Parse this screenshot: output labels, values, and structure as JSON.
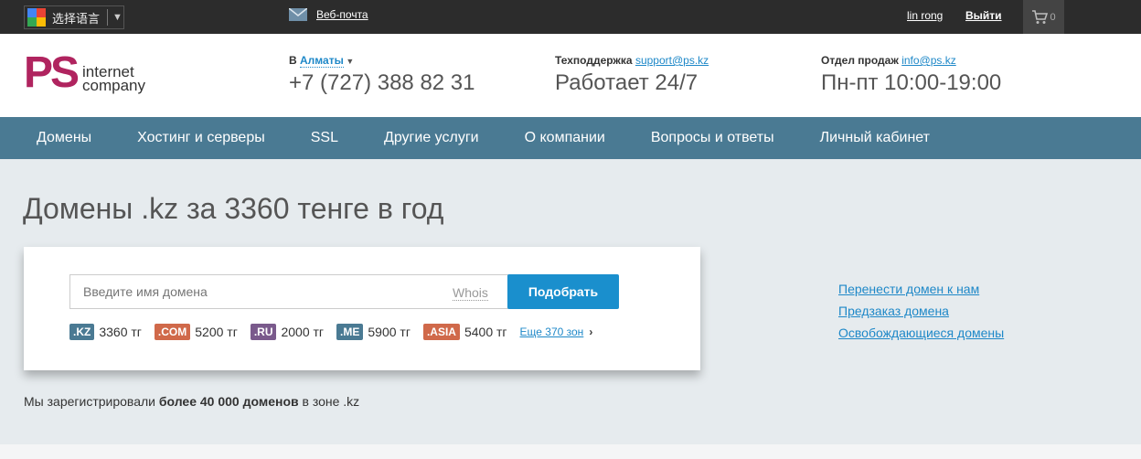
{
  "topbar": {
    "lang_label": "选择语言",
    "lang_arrow": "▼",
    "webmail": "Веб-почта",
    "user": "lin rong",
    "logout": "Выйти",
    "cart_count": "0"
  },
  "header": {
    "logo_ps": "PS",
    "logo_line1": "internet",
    "logo_line2": "company",
    "city_prefix": "В",
    "city": "Алматы",
    "phone": "+7 (727) 388 82 31",
    "support_label": "Техподдержка",
    "support_email": "support@ps.kz",
    "support_hours": "Работает 24/7",
    "sales_label": "Отдел продаж",
    "sales_email": "info@ps.kz",
    "sales_hours": "Пн-пт 10:00-19:00"
  },
  "nav": [
    {
      "label": "Домены"
    },
    {
      "label": "Хостинг и серверы"
    },
    {
      "label": "SSL"
    },
    {
      "label": "Другие услуги"
    },
    {
      "label": "О компании"
    },
    {
      "label": "Вопросы и ответы"
    },
    {
      "label": "Личный кабинет"
    }
  ],
  "main": {
    "title": "Домены .kz за 3360 тенге в год",
    "search_placeholder": "Введите имя домена",
    "whois": "Whois",
    "submit": "Подобрать",
    "zones": [
      {
        "tag": ".KZ",
        "price": "3360 тг",
        "color": "#4a7a93"
      },
      {
        "tag": ".COM",
        "price": "5200 тг",
        "color": "#d0694a"
      },
      {
        "tag": ".RU",
        "price": "2000 тг",
        "color": "#7a5a8c"
      },
      {
        "tag": ".ME",
        "price": "5900 тг",
        "color": "#4a7a93"
      },
      {
        "tag": ".ASIA",
        "price": "5400 тг",
        "color": "#d0694a"
      }
    ],
    "more_zones": "Еще 370 зон",
    "side_links": [
      "Перенести домен к нам",
      "Предзаказ домена",
      "Освобождающиеся домены"
    ],
    "note_pre": "Мы зарегистрировали",
    "note_bold": "более 40 000 доменов",
    "note_post": "в зоне .kz"
  }
}
